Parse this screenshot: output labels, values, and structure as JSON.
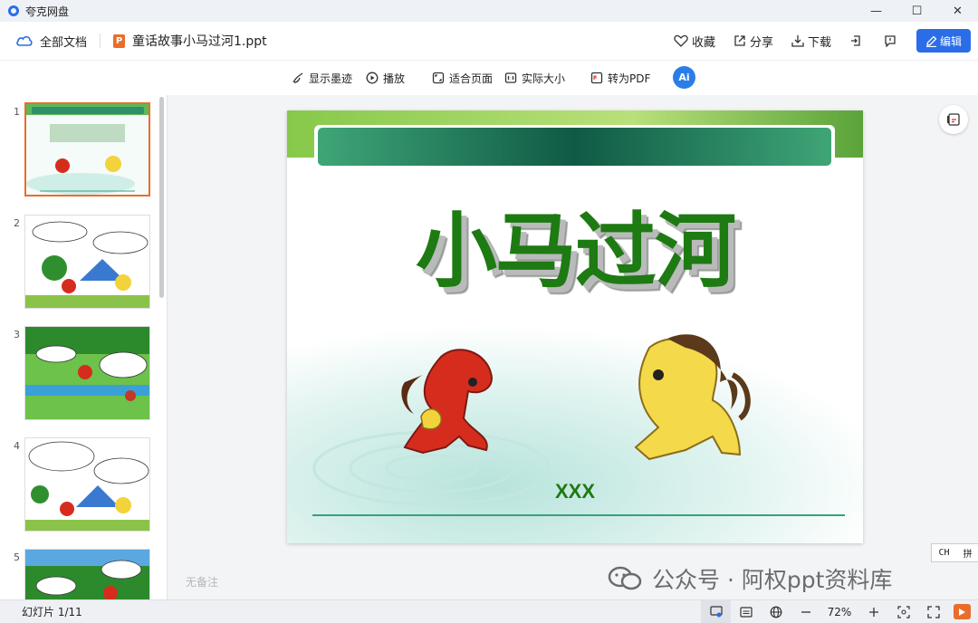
{
  "window": {
    "app_title": "夸克网盘",
    "controls": [
      "—",
      "☐",
      "✕"
    ]
  },
  "header": {
    "all_docs": "全部文档",
    "file_badge": "P",
    "file_name": "童话故事小马过河1.ppt",
    "favorite": "收藏",
    "share": "分享",
    "download": "下载",
    "edit": "编辑"
  },
  "toolbar": {
    "show_ink": "显示墨迹",
    "play": "播放",
    "fit_page": "适合页面",
    "actual_size": "实际大小",
    "to_pdf": "转为PDF",
    "ai_label": "Ai"
  },
  "thumbnails": [
    {
      "num": "1",
      "active": true
    },
    {
      "num": "2",
      "active": false
    },
    {
      "num": "3",
      "active": false
    },
    {
      "num": "4",
      "active": false
    },
    {
      "num": "5",
      "active": false
    }
  ],
  "slide": {
    "title": "小马过河",
    "author": "XXX"
  },
  "notes_placeholder": "无备注",
  "ime": {
    "lang": "CH",
    "mode": "拼"
  },
  "watermark": "公众号 · 阿权ppt资料库",
  "status": {
    "slide_counter": "幻灯片 1/11",
    "zoom": "72%"
  }
}
